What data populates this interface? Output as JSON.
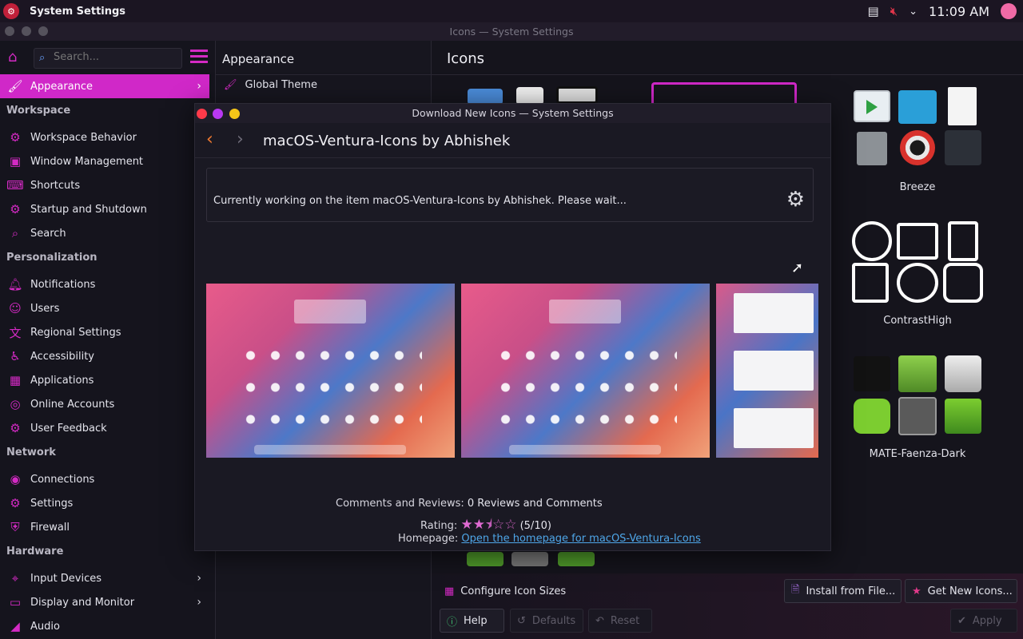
{
  "top_panel": {
    "app_title": "System Settings",
    "clock": "11:09 AM"
  },
  "main_window": {
    "title": "Icons — System Settings"
  },
  "sidebar": {
    "search_placeholder": "Search...",
    "selected": {
      "label": "Appearance",
      "icon": "brush-icon"
    },
    "sections": [
      {
        "heading": "Workspace",
        "items": [
          {
            "label": "Workspace Behavior",
            "icon": "workspace-icon"
          },
          {
            "label": "Window Management",
            "icon": "window-icon"
          },
          {
            "label": "Shortcuts",
            "icon": "keyboard-icon"
          },
          {
            "label": "Startup and Shutdown",
            "icon": "power-gear-icon"
          },
          {
            "label": "Search",
            "icon": "search-icon"
          }
        ]
      },
      {
        "heading": "Personalization",
        "items": [
          {
            "label": "Notifications",
            "icon": "bell-icon"
          },
          {
            "label": "Users",
            "icon": "user-icon"
          },
          {
            "label": "Regional Settings",
            "icon": "language-icon"
          },
          {
            "label": "Accessibility",
            "icon": "accessibility-icon"
          },
          {
            "label": "Applications",
            "icon": "apps-grid-icon"
          },
          {
            "label": "Online Accounts",
            "icon": "accounts-icon"
          },
          {
            "label": "User Feedback",
            "icon": "feedback-icon"
          }
        ]
      },
      {
        "heading": "Network",
        "items": [
          {
            "label": "Connections",
            "icon": "globe-icon"
          },
          {
            "label": "Settings",
            "icon": "network-settings-icon"
          },
          {
            "label": "Firewall",
            "icon": "shield-icon"
          }
        ]
      },
      {
        "heading": "Hardware",
        "items": [
          {
            "label": "Input Devices",
            "icon": "mouse-icon"
          },
          {
            "label": "Display and Monitor",
            "icon": "monitor-icon"
          },
          {
            "label": "Audio",
            "icon": "speaker-icon"
          }
        ]
      }
    ]
  },
  "middle": {
    "header": "Appearance",
    "item": "Global Theme"
  },
  "right": {
    "header": "Icons",
    "themes": [
      "Breeze",
      "ContrastHigh",
      "MATE-Faenza-Dark"
    ],
    "buttons": {
      "configure": "Configure Icon Sizes",
      "install": "Install from File...",
      "get_new": "Get New Icons...",
      "help": "Help",
      "defaults": "Defaults",
      "reset": "Reset",
      "apply": "Apply"
    }
  },
  "dialog": {
    "title": "Download New Icons — System Settings",
    "item_title": "macOS-Ventura-Icons by Abhishek",
    "status": "Currently working on the item macOS-Ventura-Icons by Abhishek. Please wait...",
    "comments_label": "Comments and Reviews:",
    "comments_value": "0 Reviews and Comments",
    "rating_label": "Rating:",
    "rating_value": "(5/10)",
    "rating_fraction": 0.5,
    "homepage_label": "Homepage:",
    "homepage_link": "Open the homepage for macOS-Ventura-Icons"
  },
  "colors": {
    "accent": "#d028c8",
    "link": "#4ea6e8",
    "back_arrow": "#f07a30"
  }
}
